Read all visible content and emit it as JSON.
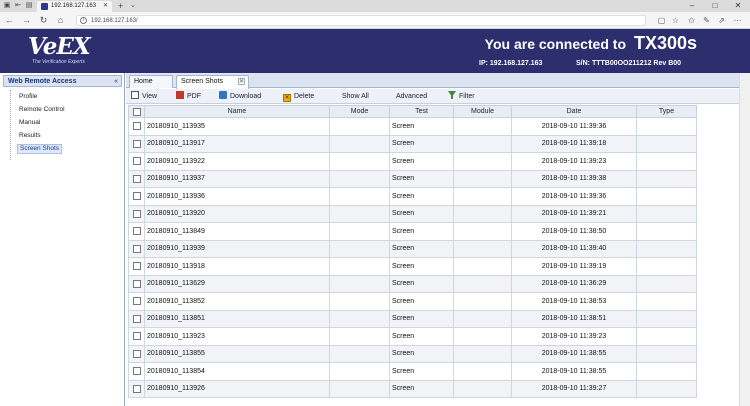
{
  "browser": {
    "tab_title": "192.168.127.163",
    "url": "192.168.127.163/",
    "new_tab_symbol": "+",
    "tab_dropdown_symbol": "⌄"
  },
  "header": {
    "logo_text": "VeEX",
    "logo_tagline": "The Verification Experts",
    "connected_text": "You are connected to",
    "device_model": "TX300s",
    "ip": "IP: 192.168.127.163",
    "serial": "S/N: TTTB00OO211212 Rev B00"
  },
  "sidebar": {
    "title": "Web Remote Access",
    "collapse_symbol": "«",
    "items": [
      {
        "label": "Profile"
      },
      {
        "label": "Remote Control"
      },
      {
        "label": "Manual"
      },
      {
        "label": "Results"
      },
      {
        "label": "Screen Shots"
      }
    ],
    "selected": "Screen Shots"
  },
  "tabs": [
    {
      "label": "Home"
    },
    {
      "label": "Screen Shots"
    }
  ],
  "toolbar": {
    "view": "View",
    "pdf": "PDF",
    "download": "Download",
    "delete": "Delete",
    "show_all": "Show All",
    "advanced": "Advanced",
    "filter": "Filter"
  },
  "table": {
    "columns": [
      "",
      "Name",
      "Mode",
      "Test",
      "Module",
      "Date",
      "Type"
    ],
    "rows": [
      {
        "name": "20180910_113935",
        "mode": "",
        "test": "Screen",
        "module": "",
        "date": "2018-09-10 11:39:36",
        "type": ""
      },
      {
        "name": "20180910_113917",
        "mode": "",
        "test": "Screen",
        "module": "",
        "date": "2018-09-10 11:39:18",
        "type": ""
      },
      {
        "name": "20180910_113922",
        "mode": "",
        "test": "Screen",
        "module": "",
        "date": "2018-09-10 11:39:23",
        "type": ""
      },
      {
        "name": "20180910_113937",
        "mode": "",
        "test": "Screen",
        "module": "",
        "date": "2018-09-10 11:39:38",
        "type": ""
      },
      {
        "name": "20180910_113936",
        "mode": "",
        "test": "Screen",
        "module": "",
        "date": "2018-09-10 11:39:36",
        "type": ""
      },
      {
        "name": "20180910_113920",
        "mode": "",
        "test": "Screen",
        "module": "",
        "date": "2018-09-10 11:39:21",
        "type": ""
      },
      {
        "name": "20180910_113849",
        "mode": "",
        "test": "Screen",
        "module": "",
        "date": "2018-09-10 11:38:50",
        "type": ""
      },
      {
        "name": "20180910_113939",
        "mode": "",
        "test": "Screen",
        "module": "",
        "date": "2018-09-10 11:39:40",
        "type": ""
      },
      {
        "name": "20180910_113918",
        "mode": "",
        "test": "Screen",
        "module": "",
        "date": "2018-09-10 11:39:19",
        "type": ""
      },
      {
        "name": "20180910_113629",
        "mode": "",
        "test": "Screen",
        "module": "",
        "date": "2018-09-10 11:36:29",
        "type": ""
      },
      {
        "name": "20180910_113852",
        "mode": "",
        "test": "Screen",
        "module": "",
        "date": "2018-09-10 11:38:53",
        "type": ""
      },
      {
        "name": "20180910_113851",
        "mode": "",
        "test": "Screen",
        "module": "",
        "date": "2018-09-10 11:38:51",
        "type": ""
      },
      {
        "name": "20180910_113923",
        "mode": "",
        "test": "Screen",
        "module": "",
        "date": "2018-09-10 11:39:23",
        "type": ""
      },
      {
        "name": "20180910_113855",
        "mode": "",
        "test": "Screen",
        "module": "",
        "date": "2018-09-10 11:38:55",
        "type": ""
      },
      {
        "name": "20180910_113854",
        "mode": "",
        "test": "Screen",
        "module": "",
        "date": "2018-09-10 11:38:55",
        "type": ""
      },
      {
        "name": "20180910_113926",
        "mode": "",
        "test": "Screen",
        "module": "",
        "date": "2018-09-10 11:39:27",
        "type": ""
      }
    ]
  },
  "colors": {
    "header_bg": "#2c2e6e",
    "panel_header_bg": "#dce4f2",
    "selected_bg": "#dde8fa"
  }
}
